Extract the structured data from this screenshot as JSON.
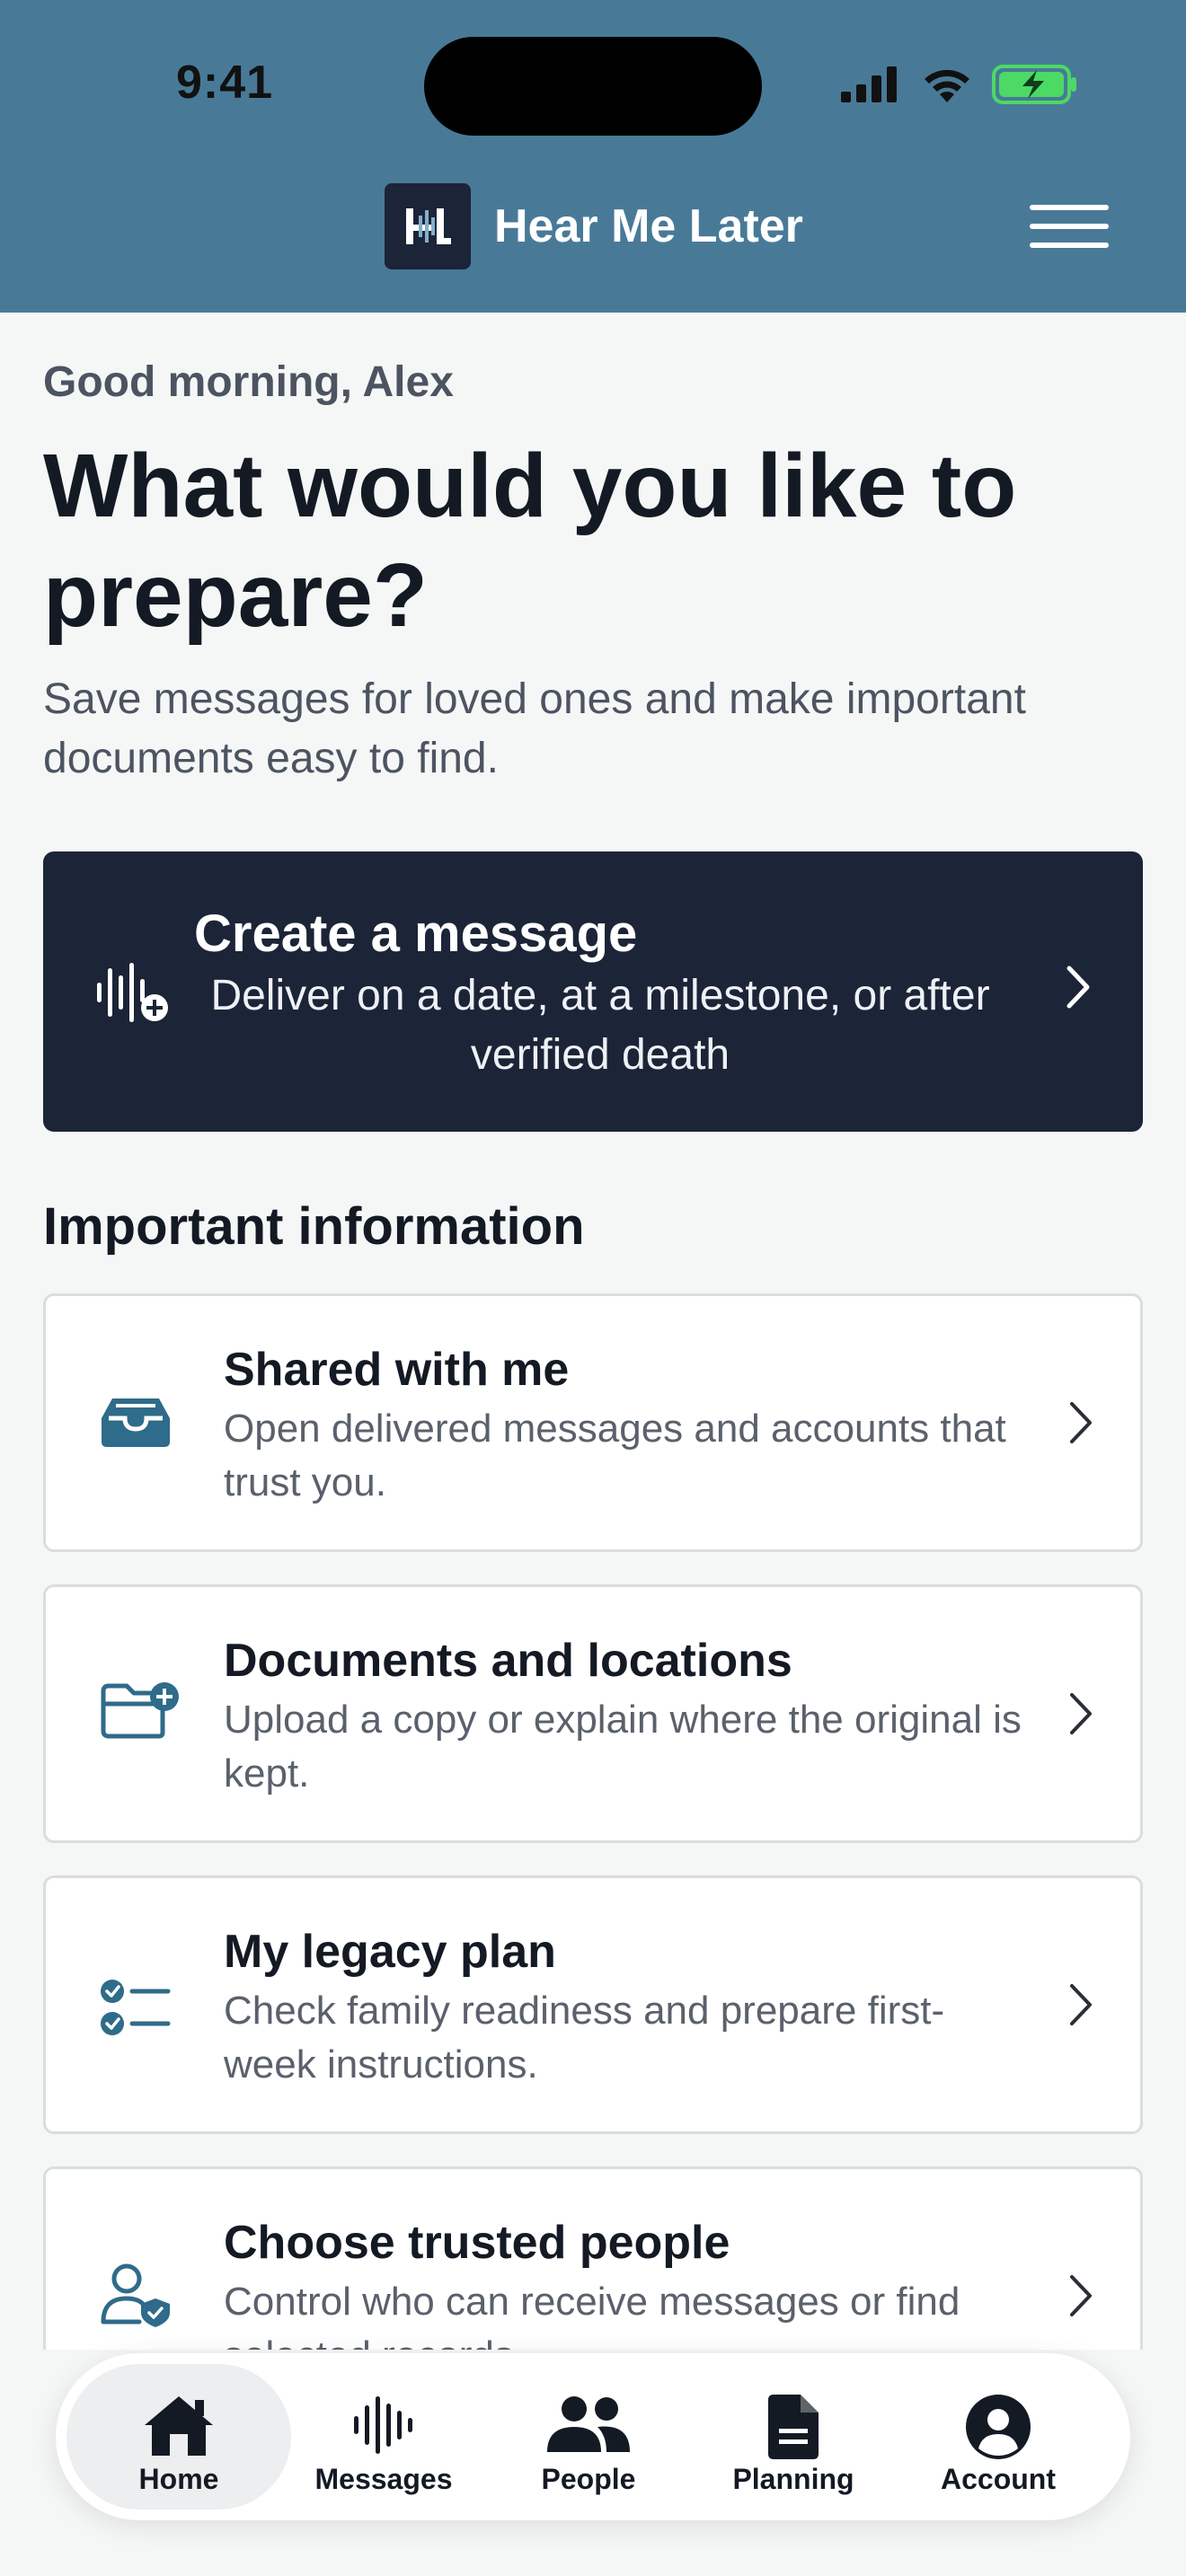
{
  "status_bar": {
    "time": "9:41"
  },
  "header": {
    "app_name": "Hear Me Later"
  },
  "greeting": "Good morning, Alex",
  "title": "What would you like to prepare?",
  "subtitle": "Save messages for loved ones and make important documents easy to find.",
  "cta": {
    "title": "Create a message",
    "description": "Deliver on a date, at a milestone, or after verified death"
  },
  "important": {
    "heading": "Important information",
    "cards": [
      {
        "title": "Shared with me",
        "description": "Open delivered messages and accounts that trust you.",
        "icon": "inbox-icon"
      },
      {
        "title": "Documents and locations",
        "description": "Upload a copy or explain where the original is kept.",
        "icon": "folder-plus-icon"
      },
      {
        "title": "My legacy plan",
        "description": "Check family readiness and prepare first-week instructions.",
        "icon": "checklist-icon"
      },
      {
        "title": "Choose trusted people",
        "description": "Control who can receive messages or find selected records.",
        "icon": "user-shield-icon"
      }
    ]
  },
  "nav": {
    "active": "Home",
    "items": [
      {
        "label": "Home",
        "icon": "home-icon"
      },
      {
        "label": "Messages",
        "icon": "waveform-icon"
      },
      {
        "label": "People",
        "icon": "people-icon"
      },
      {
        "label": "Planning",
        "icon": "document-icon"
      },
      {
        "label": "Account",
        "icon": "account-icon"
      }
    ]
  },
  "colors": {
    "header": "#487a98",
    "dark_card": "#1c2437",
    "icon_accent": "#2f6b8a",
    "battery": "#4cd964"
  }
}
